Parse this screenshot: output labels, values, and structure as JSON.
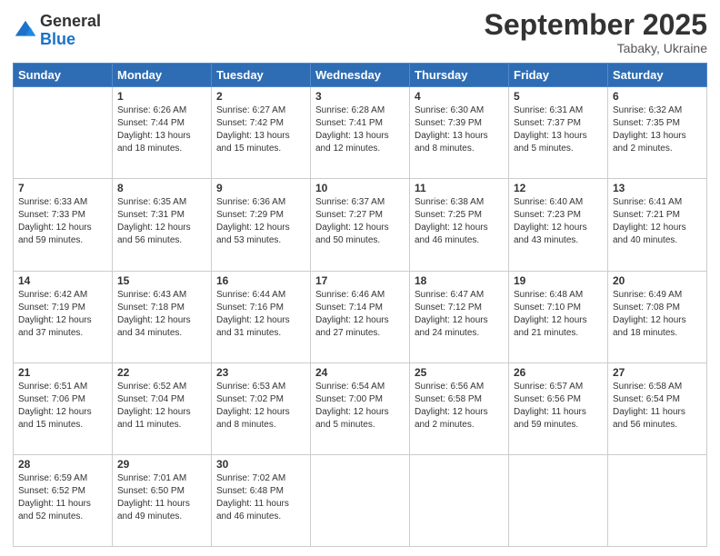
{
  "header": {
    "logo_general": "General",
    "logo_blue": "Blue",
    "month_title": "September 2025",
    "location": "Tabaky, Ukraine"
  },
  "days_of_week": [
    "Sunday",
    "Monday",
    "Tuesday",
    "Wednesday",
    "Thursday",
    "Friday",
    "Saturday"
  ],
  "weeks": [
    [
      {
        "day": "",
        "sunrise": "",
        "sunset": "",
        "daylight": ""
      },
      {
        "day": "1",
        "sunrise": "Sunrise: 6:26 AM",
        "sunset": "Sunset: 7:44 PM",
        "daylight": "Daylight: 13 hours and 18 minutes."
      },
      {
        "day": "2",
        "sunrise": "Sunrise: 6:27 AM",
        "sunset": "Sunset: 7:42 PM",
        "daylight": "Daylight: 13 hours and 15 minutes."
      },
      {
        "day": "3",
        "sunrise": "Sunrise: 6:28 AM",
        "sunset": "Sunset: 7:41 PM",
        "daylight": "Daylight: 13 hours and 12 minutes."
      },
      {
        "day": "4",
        "sunrise": "Sunrise: 6:30 AM",
        "sunset": "Sunset: 7:39 PM",
        "daylight": "Daylight: 13 hours and 8 minutes."
      },
      {
        "day": "5",
        "sunrise": "Sunrise: 6:31 AM",
        "sunset": "Sunset: 7:37 PM",
        "daylight": "Daylight: 13 hours and 5 minutes."
      },
      {
        "day": "6",
        "sunrise": "Sunrise: 6:32 AM",
        "sunset": "Sunset: 7:35 PM",
        "daylight": "Daylight: 13 hours and 2 minutes."
      }
    ],
    [
      {
        "day": "7",
        "sunrise": "Sunrise: 6:33 AM",
        "sunset": "Sunset: 7:33 PM",
        "daylight": "Daylight: 12 hours and 59 minutes."
      },
      {
        "day": "8",
        "sunrise": "Sunrise: 6:35 AM",
        "sunset": "Sunset: 7:31 PM",
        "daylight": "Daylight: 12 hours and 56 minutes."
      },
      {
        "day": "9",
        "sunrise": "Sunrise: 6:36 AM",
        "sunset": "Sunset: 7:29 PM",
        "daylight": "Daylight: 12 hours and 53 minutes."
      },
      {
        "day": "10",
        "sunrise": "Sunrise: 6:37 AM",
        "sunset": "Sunset: 7:27 PM",
        "daylight": "Daylight: 12 hours and 50 minutes."
      },
      {
        "day": "11",
        "sunrise": "Sunrise: 6:38 AM",
        "sunset": "Sunset: 7:25 PM",
        "daylight": "Daylight: 12 hours and 46 minutes."
      },
      {
        "day": "12",
        "sunrise": "Sunrise: 6:40 AM",
        "sunset": "Sunset: 7:23 PM",
        "daylight": "Daylight: 12 hours and 43 minutes."
      },
      {
        "day": "13",
        "sunrise": "Sunrise: 6:41 AM",
        "sunset": "Sunset: 7:21 PM",
        "daylight": "Daylight: 12 hours and 40 minutes."
      }
    ],
    [
      {
        "day": "14",
        "sunrise": "Sunrise: 6:42 AM",
        "sunset": "Sunset: 7:19 PM",
        "daylight": "Daylight: 12 hours and 37 minutes."
      },
      {
        "day": "15",
        "sunrise": "Sunrise: 6:43 AM",
        "sunset": "Sunset: 7:18 PM",
        "daylight": "Daylight: 12 hours and 34 minutes."
      },
      {
        "day": "16",
        "sunrise": "Sunrise: 6:44 AM",
        "sunset": "Sunset: 7:16 PM",
        "daylight": "Daylight: 12 hours and 31 minutes."
      },
      {
        "day": "17",
        "sunrise": "Sunrise: 6:46 AM",
        "sunset": "Sunset: 7:14 PM",
        "daylight": "Daylight: 12 hours and 27 minutes."
      },
      {
        "day": "18",
        "sunrise": "Sunrise: 6:47 AM",
        "sunset": "Sunset: 7:12 PM",
        "daylight": "Daylight: 12 hours and 24 minutes."
      },
      {
        "day": "19",
        "sunrise": "Sunrise: 6:48 AM",
        "sunset": "Sunset: 7:10 PM",
        "daylight": "Daylight: 12 hours and 21 minutes."
      },
      {
        "day": "20",
        "sunrise": "Sunrise: 6:49 AM",
        "sunset": "Sunset: 7:08 PM",
        "daylight": "Daylight: 12 hours and 18 minutes."
      }
    ],
    [
      {
        "day": "21",
        "sunrise": "Sunrise: 6:51 AM",
        "sunset": "Sunset: 7:06 PM",
        "daylight": "Daylight: 12 hours and 15 minutes."
      },
      {
        "day": "22",
        "sunrise": "Sunrise: 6:52 AM",
        "sunset": "Sunset: 7:04 PM",
        "daylight": "Daylight: 12 hours and 11 minutes."
      },
      {
        "day": "23",
        "sunrise": "Sunrise: 6:53 AM",
        "sunset": "Sunset: 7:02 PM",
        "daylight": "Daylight: 12 hours and 8 minutes."
      },
      {
        "day": "24",
        "sunrise": "Sunrise: 6:54 AM",
        "sunset": "Sunset: 7:00 PM",
        "daylight": "Daylight: 12 hours and 5 minutes."
      },
      {
        "day": "25",
        "sunrise": "Sunrise: 6:56 AM",
        "sunset": "Sunset: 6:58 PM",
        "daylight": "Daylight: 12 hours and 2 minutes."
      },
      {
        "day": "26",
        "sunrise": "Sunrise: 6:57 AM",
        "sunset": "Sunset: 6:56 PM",
        "daylight": "Daylight: 11 hours and 59 minutes."
      },
      {
        "day": "27",
        "sunrise": "Sunrise: 6:58 AM",
        "sunset": "Sunset: 6:54 PM",
        "daylight": "Daylight: 11 hours and 56 minutes."
      }
    ],
    [
      {
        "day": "28",
        "sunrise": "Sunrise: 6:59 AM",
        "sunset": "Sunset: 6:52 PM",
        "daylight": "Daylight: 11 hours and 52 minutes."
      },
      {
        "day": "29",
        "sunrise": "Sunrise: 7:01 AM",
        "sunset": "Sunset: 6:50 PM",
        "daylight": "Daylight: 11 hours and 49 minutes."
      },
      {
        "day": "30",
        "sunrise": "Sunrise: 7:02 AM",
        "sunset": "Sunset: 6:48 PM",
        "daylight": "Daylight: 11 hours and 46 minutes."
      },
      {
        "day": "",
        "sunrise": "",
        "sunset": "",
        "daylight": ""
      },
      {
        "day": "",
        "sunrise": "",
        "sunset": "",
        "daylight": ""
      },
      {
        "day": "",
        "sunrise": "",
        "sunset": "",
        "daylight": ""
      },
      {
        "day": "",
        "sunrise": "",
        "sunset": "",
        "daylight": ""
      }
    ]
  ]
}
